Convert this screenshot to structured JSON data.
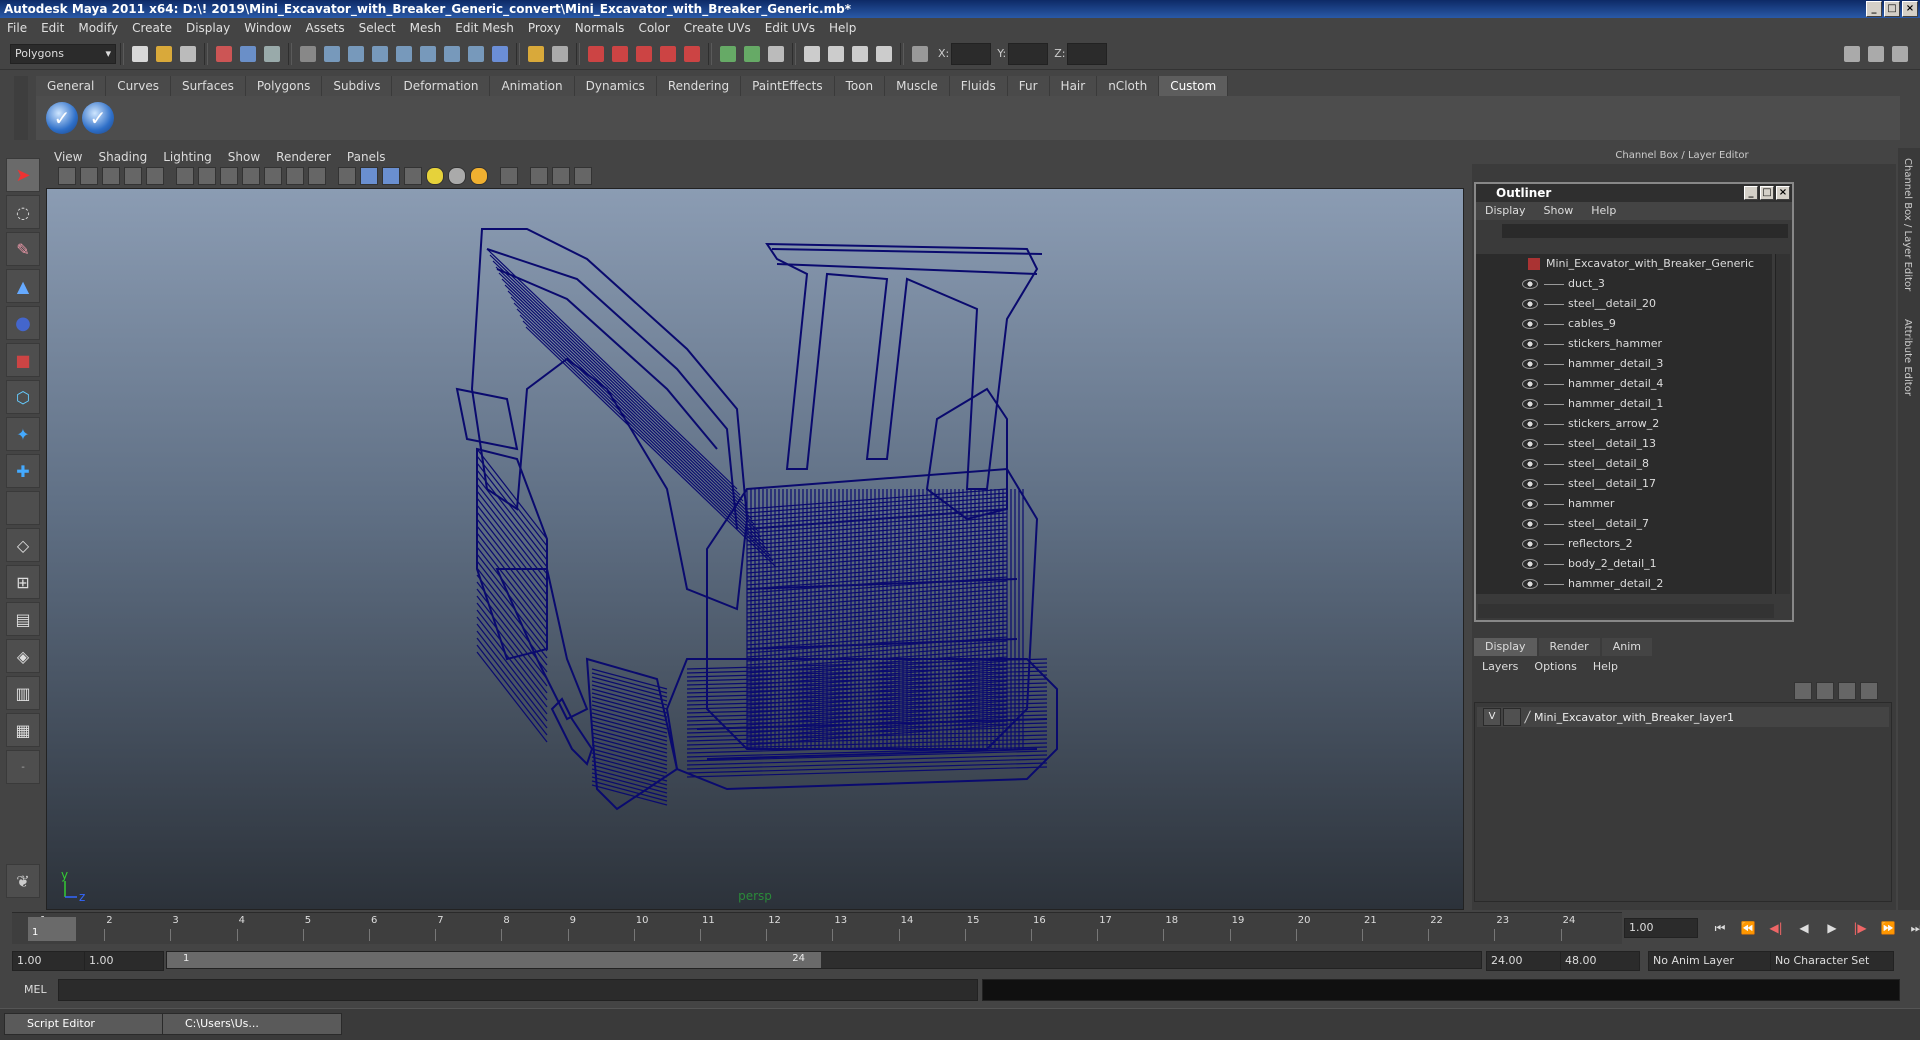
{
  "window": {
    "title": "Autodesk Maya 2011 x64: D:\\! 2019\\Mini_Excavator_with_Breaker_Generic_convert\\Mini_Excavator_with_Breaker_Generic.mb*"
  },
  "menubar": [
    "File",
    "Edit",
    "Modify",
    "Create",
    "Display",
    "Window",
    "Assets",
    "Select",
    "Mesh",
    "Edit Mesh",
    "Proxy",
    "Normals",
    "Color",
    "Create UVs",
    "Edit UVs",
    "Help"
  ],
  "statusline": {
    "menuset": "Polygons",
    "x_label": "X:",
    "y_label": "Y:",
    "z_label": "Z:"
  },
  "shelf": {
    "tabs": [
      "General",
      "Curves",
      "Surfaces",
      "Polygons",
      "Subdivs",
      "Deformation",
      "Animation",
      "Dynamics",
      "Rendering",
      "PaintEffects",
      "Toon",
      "Muscle",
      "Fluids",
      "Fur",
      "Hair",
      "nCloth",
      "Custom"
    ],
    "active_tab": "Custom"
  },
  "viewport": {
    "menu": [
      "View",
      "Shading",
      "Lighting",
      "Show",
      "Renderer",
      "Panels"
    ],
    "camera_label": "persp",
    "axis_y": "y",
    "axis_z": "z",
    "wireframe_color": "#0a0a6e"
  },
  "dock": {
    "header": "Channel Box / Layer Editor",
    "side_tabs": [
      "Channel Box / Layer Editor",
      "Attribute Editor"
    ]
  },
  "outliner": {
    "title": "Outliner",
    "menu": [
      "Display",
      "Show",
      "Help"
    ],
    "root": "Mini_Excavator_with_Breaker_Generic",
    "items": [
      "duct_3",
      "steel__detail_20",
      "cables_9",
      "stickers_hammer",
      "hammer_detail_3",
      "hammer_detail_4",
      "hammer_detail_1",
      "stickers_arrow_2",
      "steel__detail_13",
      "steel__detail_8",
      "steel__detail_17",
      "hammer",
      "steel__detail_7",
      "reflectors_2",
      "body_2_detail_1",
      "hammer_detail_2"
    ]
  },
  "layer_editor": {
    "tabs": [
      "Display",
      "Render",
      "Anim"
    ],
    "active_tab": "Display",
    "menu": [
      "Layers",
      "Options",
      "Help"
    ],
    "layers": [
      {
        "visible": "V",
        "name": "Mini_Excavator_with_Breaker_layer1"
      }
    ]
  },
  "timeline": {
    "ticks": [
      "1",
      "2",
      "3",
      "4",
      "5",
      "6",
      "7",
      "8",
      "9",
      "10",
      "11",
      "12",
      "13",
      "14",
      "15",
      "16",
      "17",
      "18",
      "19",
      "20",
      "21",
      "22",
      "23",
      "24"
    ],
    "current_frame": "1",
    "current_time_field": "1.00"
  },
  "range": {
    "start_time": "1.00",
    "playback_start": "1.00",
    "range_start": "1",
    "range_end": "24",
    "playback_end": "24.00",
    "end_time": "48.00",
    "anim_layer": "No Anim Layer",
    "character_set": "No Character Set"
  },
  "command_line": {
    "label": "MEL"
  },
  "taskbar": [
    {
      "label": "Script Editor"
    },
    {
      "label": "C:\\Users\\Us..."
    }
  ]
}
